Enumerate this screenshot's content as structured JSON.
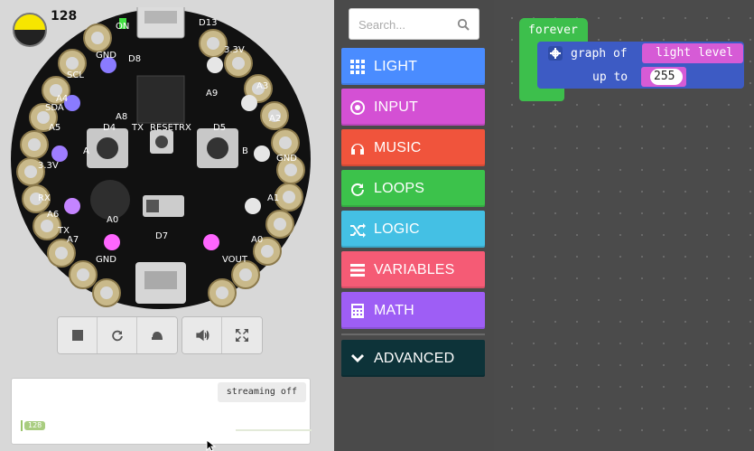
{
  "simulator": {
    "light_level": "128",
    "board_labels": [
      "GND",
      "SCL",
      "A4",
      "SDA",
      "A5",
      "3.3V",
      "RX",
      "A6",
      "TX",
      "A7",
      "GND",
      "D8",
      "D13",
      "A9",
      "A8",
      "D4",
      "TX",
      "RESET",
      "RX",
      "D5",
      "A",
      "B",
      "A0",
      "D7",
      "A0",
      "VOUT",
      "A1",
      "GND",
      "A2",
      "A3",
      "3.3V",
      "ON"
    ],
    "toolbar": [
      "stop",
      "restart",
      "slow-motion",
      "sound",
      "fullscreen"
    ],
    "serial": {
      "streaming_label": "streaming off",
      "value": "128"
    }
  },
  "toolbox": {
    "search_placeholder": "Search...",
    "categories": [
      {
        "label": "LIGHT",
        "icon": "grid-icon",
        "color": "#4a8cff"
      },
      {
        "label": "INPUT",
        "icon": "target-icon",
        "color": "#d450d4"
      },
      {
        "label": "MUSIC",
        "icon": "headphones-icon",
        "color": "#f0543c"
      },
      {
        "label": "LOOPS",
        "icon": "refresh-icon",
        "color": "#3cc24b"
      },
      {
        "label": "LOGIC",
        "icon": "shuffle-icon",
        "color": "#44c0e4"
      },
      {
        "label": "VARIABLES",
        "icon": "list-icon",
        "color": "#f55b75"
      },
      {
        "label": "MATH",
        "icon": "calculator-icon",
        "color": "#9e5ef5"
      },
      {
        "label": "ADVANCED",
        "icon": "chevron-down-icon",
        "color": "#0d3339"
      }
    ]
  },
  "workspace": {
    "forever_label": "forever",
    "graph_label": "graph of",
    "light_label": "light level",
    "upto_label": "up to",
    "upto_value": "255"
  },
  "colors": {
    "forever": "#3dbf4c",
    "graph": "#3d5bc4",
    "input_block": "#d65bd6"
  }
}
